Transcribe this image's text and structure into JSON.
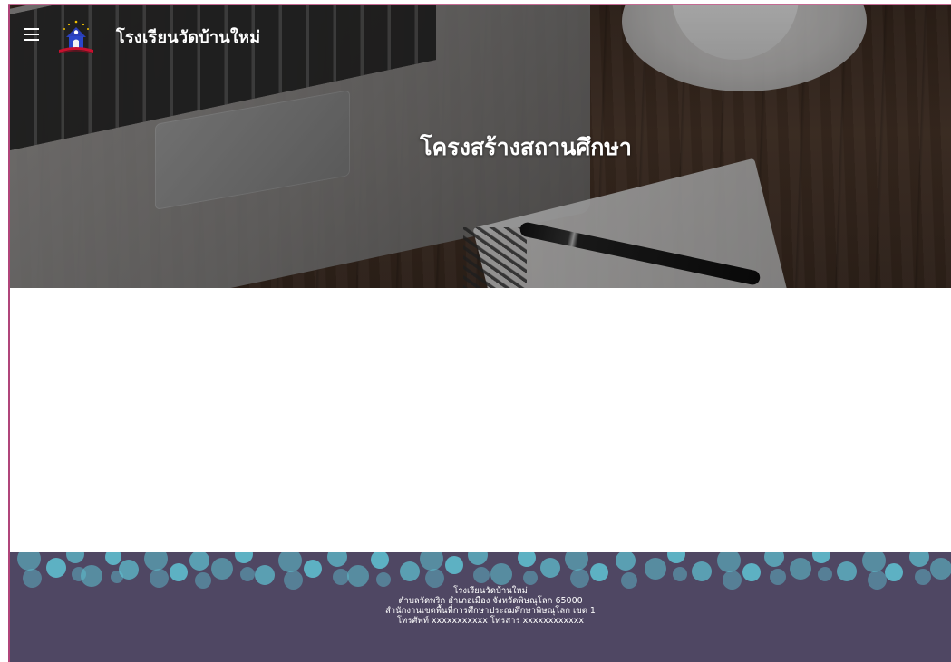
{
  "header": {
    "site_title": "โรงเรียนวัดบ้านใหม่",
    "menu_icon": "hamburger-menu-icon",
    "logo_icon": "school-logo-icon"
  },
  "hero": {
    "heading": "โครงสร้างสถานศึกษา"
  },
  "footer": {
    "line1": "โรงเรียนวัดบ้านใหม่",
    "line2": "ตำบลวัดพริก อำเภอเมือง จังหวัดพิษณุโลก 65000",
    "line3": "สำนักงานเขตพื้นที่การศึกษาประถมศึกษาพิษณุโลก เขต 1",
    "line4": "โทรศัพท์ xxxxxxxxxxx โทรสาร xxxxxxxxxxxx"
  },
  "colors": {
    "footer_bg": "#4f4763",
    "bokeh": "#5fc4d4",
    "frame_border": "#b0457a"
  }
}
